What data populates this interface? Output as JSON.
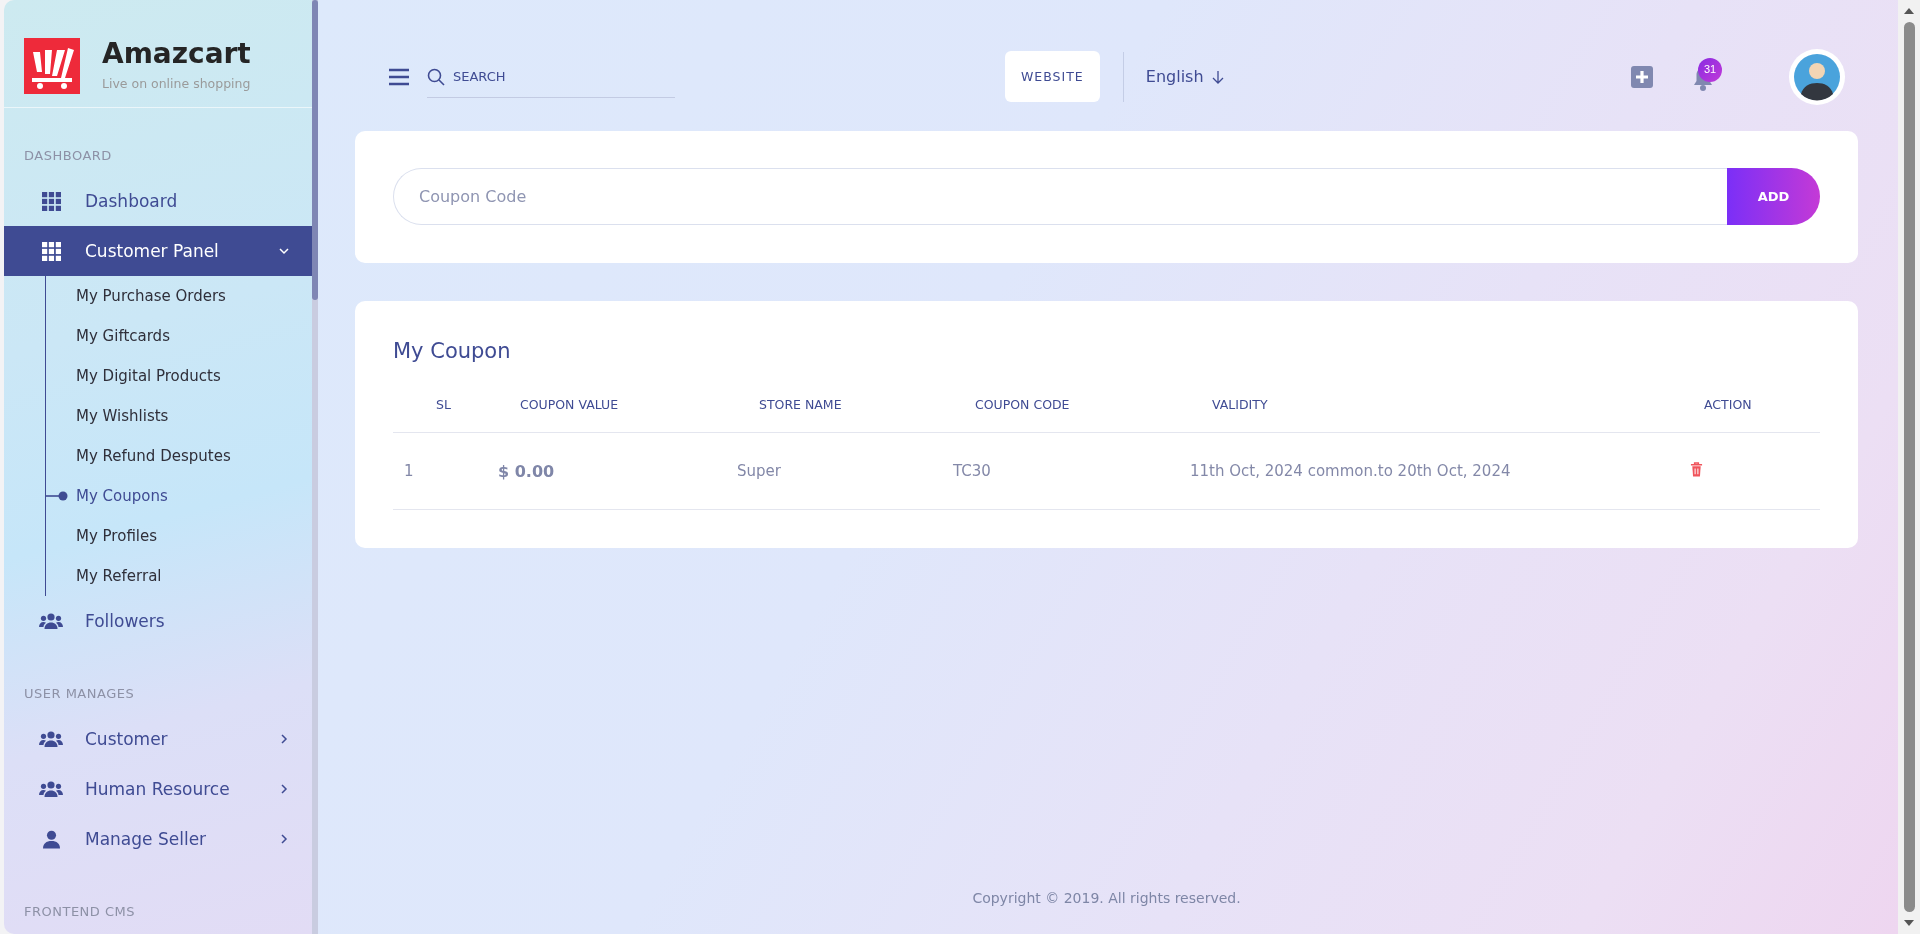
{
  "brand": {
    "name": "Amazcart",
    "tagline": "Live on online shopping"
  },
  "sidebar": {
    "sections": [
      {
        "title": "DASHBOARD",
        "items": [
          {
            "label": "Dashboard",
            "kind": "link",
            "selected": false
          },
          {
            "label": "Customer Panel",
            "kind": "menu",
            "selected": true,
            "expanded": true,
            "children": [
              {
                "label": "My Purchase Orders",
                "selected": false
              },
              {
                "label": "My Giftcards",
                "selected": false
              },
              {
                "label": "My Digital Products",
                "selected": false
              },
              {
                "label": "My Wishlists",
                "selected": false
              },
              {
                "label": "My Refund Desputes",
                "selected": false
              },
              {
                "label": "My Coupons",
                "selected": true
              },
              {
                "label": "My Profiles",
                "selected": false
              },
              {
                "label": "My Referral",
                "selected": false
              }
            ]
          },
          {
            "label": "Followers",
            "kind": "link",
            "selected": false
          }
        ]
      },
      {
        "title": "USER MANAGES",
        "items": [
          {
            "label": "Customer",
            "kind": "menu",
            "selected": false,
            "expanded": false
          },
          {
            "label": "Human Resource",
            "kind": "menu",
            "selected": false,
            "expanded": false
          },
          {
            "label": "Manage Seller",
            "kind": "menu",
            "selected": false,
            "expanded": false
          }
        ]
      },
      {
        "title": "FRONTEND CMS"
      }
    ]
  },
  "topbar": {
    "search": {
      "placeholder": "SEARCH"
    },
    "website_button": "WEBSITE",
    "language": "English",
    "notifications": {
      "count": "31"
    }
  },
  "coupon_form": {
    "placeholder": "Coupon Code",
    "button": "ADD"
  },
  "coupon_table": {
    "title": "My Coupon",
    "columns": [
      "SL",
      "COUPON VALUE",
      "STORE NAME",
      "COUPON CODE",
      "VALIDITY",
      "ACTION"
    ],
    "rows": [
      {
        "sl": "1",
        "coupon_value": "$ 0.00",
        "store_name": "Super",
        "coupon_code": "TC30",
        "validity": "11th Oct, 2024 common.to 20th Oct, 2024"
      }
    ]
  },
  "footer": {
    "copyright": "Copyright © 2019. All rights reserved."
  }
}
